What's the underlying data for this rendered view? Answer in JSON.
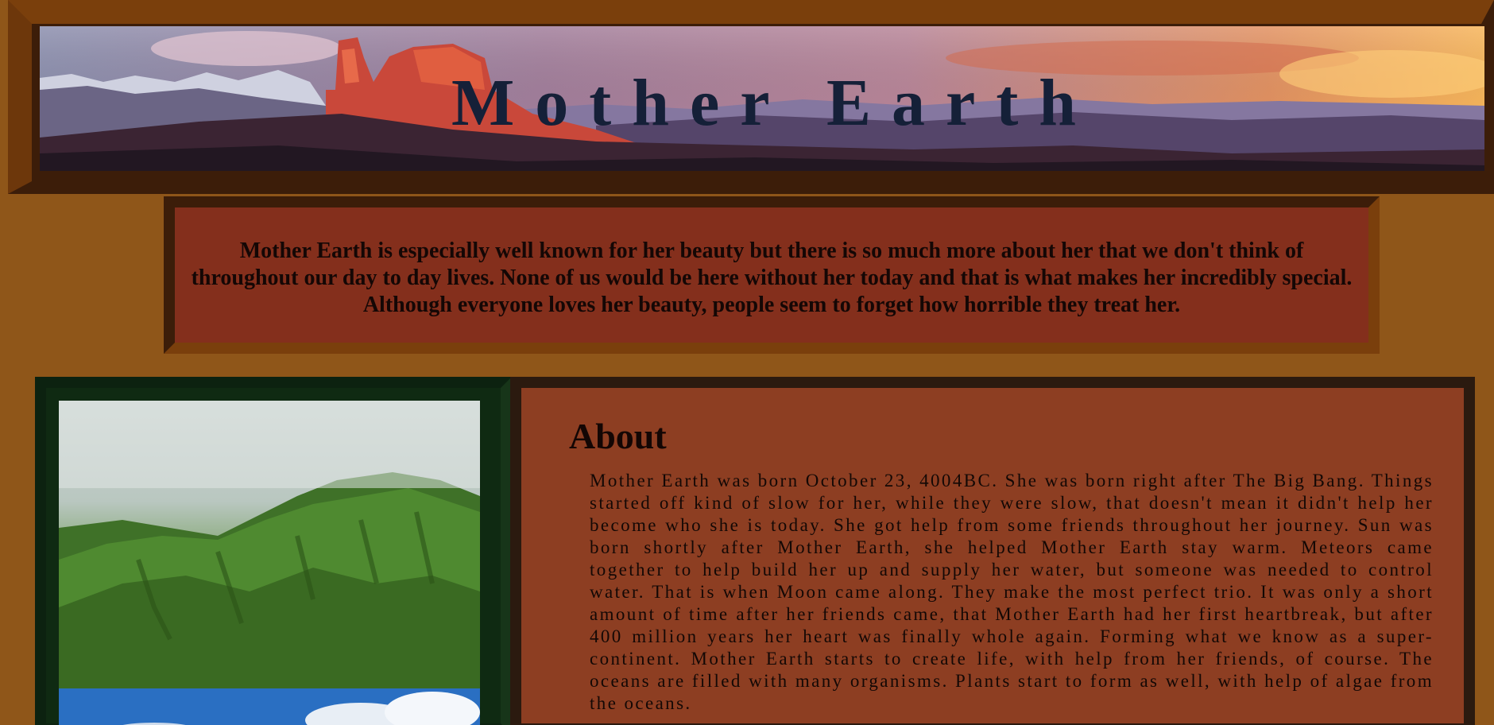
{
  "header": {
    "title": "Mother Earth"
  },
  "intro": {
    "text": "Mother Earth is especially well known for her beauty but there is so much more about her that we don't think of throughout our day to day lives. None of us would be here without her today and that is what makes her incredibly special. Although everyone loves her beauty, people seem to forget how horrible they treat her."
  },
  "about": {
    "heading": "About",
    "text": "Mother Earth was born October 23, 4004BC. She was born right after The Big Bang. Things started off kind of slow for her, while they were slow, that doesn't mean it didn't help her become who she is today. She got help from some friends throughout her journey. Sun was born shortly after Mother Earth, she helped Mother Earth stay warm. Meteors came together to help build her up and supply her water, but someone was needed to control water. That is when Moon came along. They make the most perfect trio. It was only a short amount of time after her friends came, that Mother Earth had her first heartbreak, but after 400 million years her heart was finally whole again. Forming what we know as a super-continent. Mother Earth starts to create life, with help from her friends, of course. The oceans are filled with many organisms. Plants start to form as well, with help of algae from the oceans."
  },
  "colors": {
    "page_background": "#8f5619",
    "frame_dark": "#3c1d09",
    "intro_background": "#842f1c",
    "about_background": "#8d3e22",
    "gallery_background": "#0f2a12",
    "title_color": "#152038"
  },
  "images": {
    "banner": "mountain-sunset-panorama",
    "gallery_top": "green-mountain-ridge",
    "gallery_bottom": "blue-sky-clouds"
  }
}
